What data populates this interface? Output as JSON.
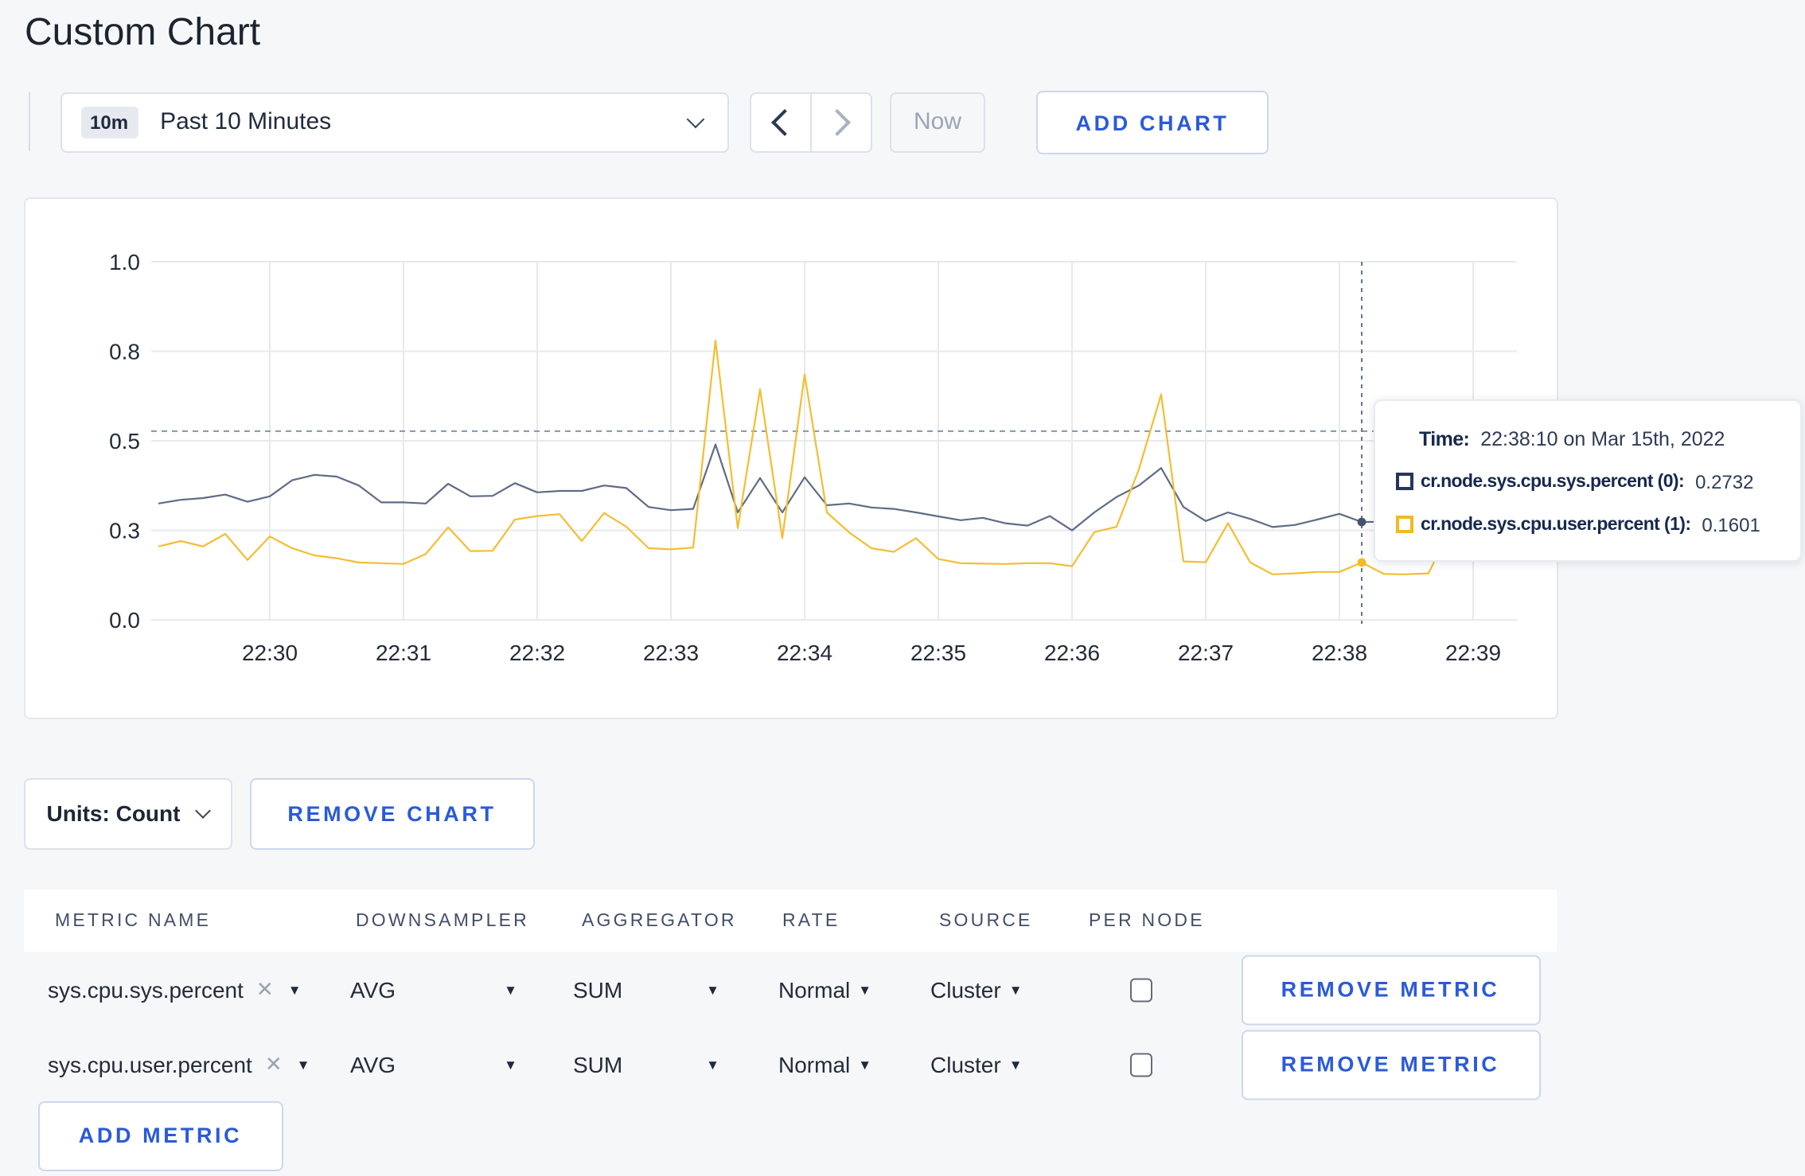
{
  "page": {
    "title": "Custom Chart"
  },
  "toolbar": {
    "time_window_badge": "10m",
    "time_window_label": "Past 10 Minutes",
    "now_label": "Now",
    "add_chart_label": "ADD CHART"
  },
  "tooltip": {
    "time_label": "Time:",
    "time_value": "22:38:10 on Mar 15th, 2022",
    "rows": [
      {
        "name": "cr.node.sys.cpu.sys.percent (0):",
        "value": "0.2732",
        "color": "#26355b"
      },
      {
        "name": "cr.node.sys.cpu.user.percent (1):",
        "value": "0.1601",
        "color": "#f0ba25"
      }
    ]
  },
  "units_row": {
    "units_label": "Units: Count",
    "remove_chart_label": "REMOVE CHART"
  },
  "metrics_table": {
    "headers": [
      "METRIC NAME",
      "DOWNSAMPLER",
      "AGGREGATOR",
      "RATE",
      "SOURCE",
      "PER NODE"
    ],
    "rows": [
      {
        "metric": "sys.cpu.sys.percent",
        "downsampler": "AVG",
        "aggregator": "SUM",
        "rate": "Normal",
        "source": "Cluster",
        "per_node": false,
        "remove_label": "REMOVE METRIC"
      },
      {
        "metric": "sys.cpu.user.percent",
        "downsampler": "AVG",
        "aggregator": "SUM",
        "rate": "Normal",
        "source": "Cluster",
        "per_node": false,
        "remove_label": "REMOVE METRIC"
      }
    ],
    "add_metric_label": "ADD METRIC"
  },
  "chart_data": {
    "type": "line",
    "title": "",
    "xlabel": "",
    "ylabel": "",
    "ylim": [
      0,
      1
    ],
    "grid": true,
    "x_ticks": [
      "22:30",
      "22:31",
      "22:32",
      "22:33",
      "22:34",
      "22:35",
      "22:36",
      "22:37",
      "22:38",
      "22:39"
    ],
    "y_ticks": [
      {
        "label": "0.0",
        "value": 0
      },
      {
        "label": "0.3",
        "value": 0.25
      },
      {
        "label": "0.5",
        "value": 0.5
      },
      {
        "label": "0.8",
        "value": 0.75
      },
      {
        "label": "1.0",
        "value": 1
      }
    ],
    "x_start_minute": 29.1667,
    "x_step_minute": 0.16667,
    "series": [
      {
        "name": "cr.node.sys.cpu.sys.percent",
        "color": "#5f6c87",
        "values": [
          0.325,
          0.335,
          0.34,
          0.35,
          0.33,
          0.345,
          0.39,
          0.405,
          0.4,
          0.375,
          0.328,
          0.328,
          0.325,
          0.38,
          0.345,
          0.346,
          0.382,
          0.356,
          0.36,
          0.36,
          0.375,
          0.368,
          0.315,
          0.306,
          0.31,
          0.49,
          0.3,
          0.396,
          0.3,
          0.398,
          0.32,
          0.325,
          0.314,
          0.31,
          0.3,
          0.289,
          0.278,
          0.285,
          0.27,
          0.263,
          0.29,
          0.25,
          0.3,
          0.343,
          0.375,
          0.424,
          0.315,
          0.276,
          0.3,
          0.282,
          0.259,
          0.265,
          0.28,
          0.296,
          0.2732,
          0.274,
          0.3,
          0.293,
          0.288,
          0.284,
          0.287,
          0.292
        ]
      },
      {
        "name": "cr.node.sys.cpu.user.percent",
        "color": "#f4be32",
        "values": [
          0.205,
          0.22,
          0.205,
          0.24,
          0.167,
          0.233,
          0.2,
          0.18,
          0.172,
          0.16,
          0.158,
          0.156,
          0.184,
          0.258,
          0.192,
          0.193,
          0.28,
          0.29,
          0.295,
          0.22,
          0.298,
          0.26,
          0.2,
          0.197,
          0.202,
          0.78,
          0.256,
          0.644,
          0.228,
          0.685,
          0.3,
          0.244,
          0.2,
          0.19,
          0.228,
          0.17,
          0.158,
          0.157,
          0.156,
          0.158,
          0.158,
          0.15,
          0.245,
          0.26,
          0.42,
          0.63,
          0.163,
          0.161,
          0.27,
          0.16,
          0.127,
          0.13,
          0.134,
          0.134,
          0.1601,
          0.128,
          0.127,
          0.13,
          0.26,
          0.28,
          0.175,
          0.24
        ]
      }
    ],
    "crosshair": {
      "point_index": 54,
      "hline_value": 0.527,
      "time_label": "22:38:10"
    }
  }
}
